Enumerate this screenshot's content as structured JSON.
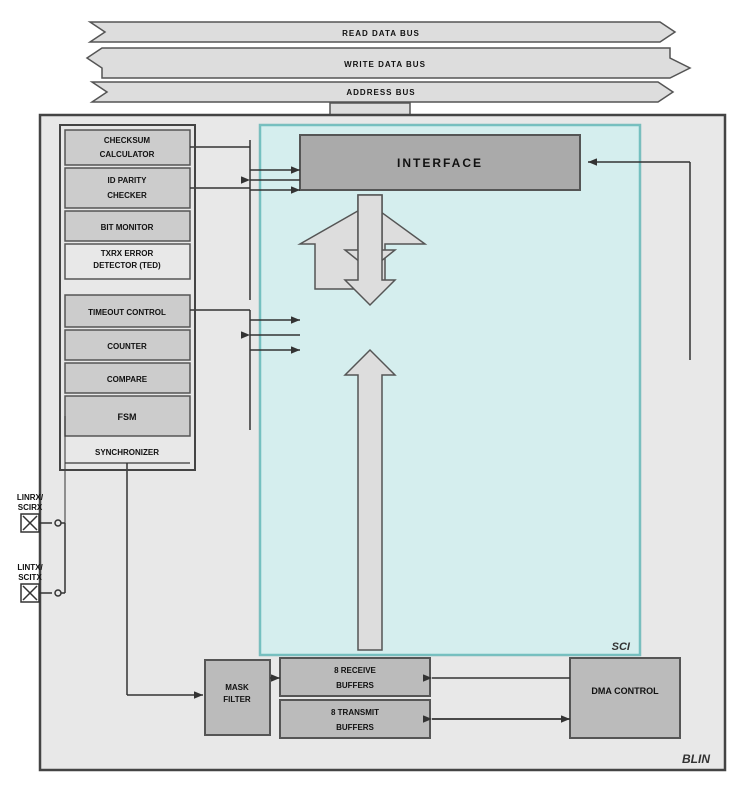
{
  "buses": [
    {
      "label": "READ DATA BUS",
      "direction": "left"
    },
    {
      "label": "WRITE DATA BUS",
      "direction": "right"
    },
    {
      "label": "ADDRESS BUS",
      "direction": "left"
    }
  ],
  "main_box_label": "BLIN",
  "sci_label": "SCI",
  "interface_label": "INTERFACE",
  "left_boxes": [
    {
      "label": "CHECKSUM\nCALCULATOR",
      "type": "box"
    },
    {
      "label": "ID PARITY\nCHECKER",
      "type": "box"
    },
    {
      "label": "BIT MONITOR",
      "type": "box"
    },
    {
      "label": "TXRX ERROR\nDETECTOR (TED)",
      "type": "plain"
    }
  ],
  "left_boxes2": [
    {
      "label": "TIMEOUT CONTROL",
      "type": "box"
    },
    {
      "label": "COUNTER",
      "type": "box"
    },
    {
      "label": "COMPARE",
      "type": "box"
    },
    {
      "label": "FSM",
      "type": "box"
    },
    {
      "label": "SYNCHRONIZER",
      "type": "plain"
    }
  ],
  "bottom_boxes": {
    "mask_filter": "MASK\nFILTER",
    "receive": "8 RECEIVE\nBUFFERS",
    "transmit": "8 TRANSMIT\nBUFFERS",
    "dma": "DMA CONTROL"
  },
  "signals": {
    "linrx_scirx": "LINRX/\nSCIRX",
    "lintx_scitx": "LINTX/\nSCITX"
  }
}
